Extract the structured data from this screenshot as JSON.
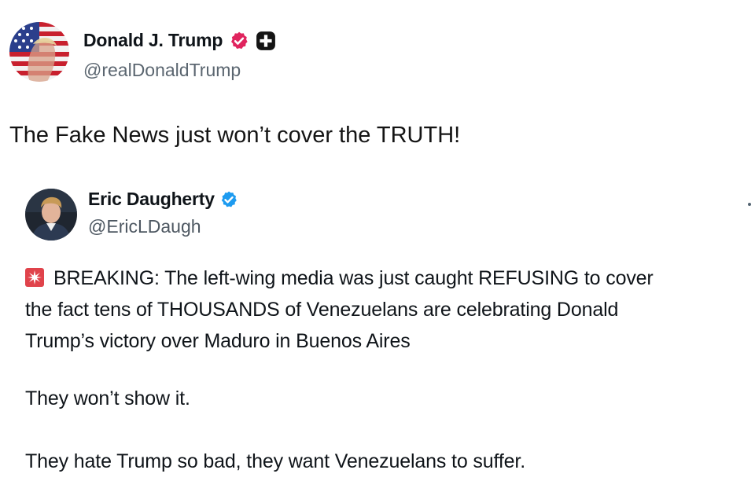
{
  "post": {
    "author_name": "Donald J. Trump",
    "author_handle": "@realDonaldTrump",
    "avatar_icon": "trump-flag-avatar-icon",
    "verified_badge_color": "#e0245e",
    "text": "The Fake News just won’t cover the TRUTH!"
  },
  "quoted_post": {
    "author_name": "Eric Daugherty",
    "author_handle": "@EricLDaugh",
    "avatar_icon": "profile-photo-icon",
    "verified_badge_color": "#1d9bf0",
    "siren_icon": "siren-emoji-icon",
    "body_lines": [
      "BREAKING: The left-wing media was just caught REFUSING to cover",
      "the fact tens of THOUSANDS of Venezuelans are celebrating Donald",
      "Trump’s victory over Maduro in Buenos Aires"
    ],
    "paragraph_2": "They won’t show it.",
    "paragraph_3": "They hate Trump so bad, they want Venezuelans to suffer."
  }
}
